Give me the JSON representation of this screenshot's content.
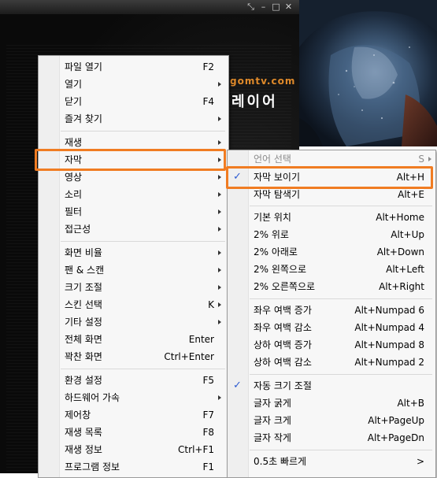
{
  "brand": {
    "url": "gomtv.com",
    "name": "레이어"
  },
  "title_buttons": [
    "⤡",
    "–",
    "□",
    "✕"
  ],
  "main_menu": {
    "items": [
      {
        "label": "파일 열기",
        "shortcut": "F2"
      },
      {
        "label": "열기",
        "submenu": true
      },
      {
        "label": "닫기",
        "shortcut": "F4"
      },
      {
        "label": "즐겨 찾기",
        "submenu": true
      },
      {
        "label": "재생",
        "submenu": true
      },
      {
        "label": "자막",
        "submenu": true
      },
      {
        "label": "영상",
        "submenu": true
      },
      {
        "label": "소리",
        "submenu": true
      },
      {
        "label": "필터",
        "submenu": true
      },
      {
        "label": "접근성",
        "submenu": true
      },
      {
        "label": "화면 비율",
        "submenu": true
      },
      {
        "label": "팬 & 스캔",
        "submenu": true
      },
      {
        "label": "크기 조절",
        "submenu": true
      },
      {
        "label": "스킨 선택",
        "shortcut": "K"
      },
      {
        "label": "기타 설정",
        "submenu": true
      },
      {
        "label": "전체 화면",
        "shortcut": "Enter"
      },
      {
        "label": "꽉찬 화면",
        "shortcut": "Ctrl+Enter"
      },
      {
        "label": "환경 설정",
        "shortcut": "F5"
      },
      {
        "label": "하드웨어 가속",
        "submenu": true
      },
      {
        "label": "제어창",
        "shortcut": "F7"
      },
      {
        "label": "재생 목록",
        "shortcut": "F8"
      },
      {
        "label": "재생 정보",
        "shortcut": "Ctrl+F1"
      },
      {
        "label": "프로그램 정보",
        "shortcut": "F1"
      }
    ]
  },
  "sub_menu": {
    "items": [
      {
        "label": "언어 선택",
        "shortcut": "S",
        "disabled": true,
        "submenu": true
      },
      {
        "label": "자막 보이기",
        "shortcut": "Alt+H",
        "checked": true
      },
      {
        "label": "자막 탐색기",
        "shortcut": "Alt+E"
      },
      {
        "label": "기본 위치",
        "shortcut": "Alt+Home"
      },
      {
        "label": "2% 위로",
        "shortcut": "Alt+Up"
      },
      {
        "label": "2% 아래로",
        "shortcut": "Alt+Down"
      },
      {
        "label": "2% 왼쪽으로",
        "shortcut": "Alt+Left"
      },
      {
        "label": "2% 오른쪽으로",
        "shortcut": "Alt+Right"
      },
      {
        "label": "좌우 여백 증가",
        "shortcut": "Alt+Numpad 6"
      },
      {
        "label": "좌우 여백 감소",
        "shortcut": "Alt+Numpad 4"
      },
      {
        "label": "상하 여백 증가",
        "shortcut": "Alt+Numpad 8"
      },
      {
        "label": "상하 여백 감소",
        "shortcut": "Alt+Numpad 2"
      },
      {
        "label": "자동 크기 조절",
        "checked": true
      },
      {
        "label": "글자 굵게",
        "shortcut": "Alt+B"
      },
      {
        "label": "글자 크게",
        "shortcut": "Alt+PageUp"
      },
      {
        "label": "글자 작게",
        "shortcut": "Alt+PageDn"
      },
      {
        "label": "0.5초 빠르게",
        "shortcut": ">"
      }
    ]
  },
  "colors": {
    "highlight": "#f07c22",
    "check": "#2d5bd1",
    "brand": "#e08a2a"
  }
}
